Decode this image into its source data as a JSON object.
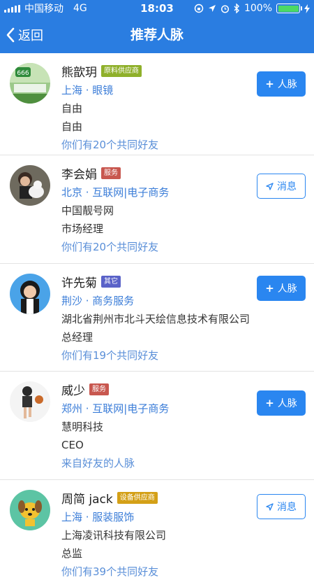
{
  "status": {
    "carrier": "中国移动",
    "network": "4G",
    "time": "18:03",
    "battery": "100%",
    "battery_level": 1.0
  },
  "nav": {
    "back_label": "返回",
    "title": "推荐人脉"
  },
  "colors": {
    "accent": "#2a7de1",
    "tag_supplier": "#8fb02a",
    "tag_service": "#c8574f",
    "tag_other": "#5a62c8",
    "tag_equipment": "#d4a017"
  },
  "people": [
    {
      "name": "熊歆玥",
      "tag": "原料供应商",
      "tag_color": "#8fb02a",
      "location": "上海 · 眼镜",
      "company": "自由",
      "title": "自由",
      "mutual": "你们有20个共同好友",
      "action": "人脉",
      "action_type": "add"
    },
    {
      "name": "李会娟",
      "tag": "服务",
      "tag_color": "#c8574f",
      "location": "北京 · 互联网|电子商务",
      "company": "中国靓号网",
      "title": "市场经理",
      "mutual": "你们有20个共同好友",
      "action": "消息",
      "action_type": "msg"
    },
    {
      "name": "许先菊",
      "tag": "其它",
      "tag_color": "#5a62c8",
      "location": "荆沙 · 商务服务",
      "company": "湖北省荆州市北斗天绘信息技术有限公司",
      "title": "总经理",
      "mutual": "你们有19个共同好友",
      "action": "人脉",
      "action_type": "add"
    },
    {
      "name": "威少",
      "tag": "服务",
      "tag_color": "#c8574f",
      "location": "郑州 · 互联网|电子商务",
      "company": "慧明科技",
      "title": "CEO",
      "mutual": "来自好友的人脉",
      "action": "人脉",
      "action_type": "add"
    },
    {
      "name": "周简 jack",
      "tag": "设备供应商",
      "tag_color": "#d4a017",
      "location": "上海 · 服装服饰",
      "company": "上海凌讯科技有限公司",
      "title": "总监",
      "mutual": "你们有39个共同好友",
      "action": "消息",
      "action_type": "msg"
    }
  ]
}
